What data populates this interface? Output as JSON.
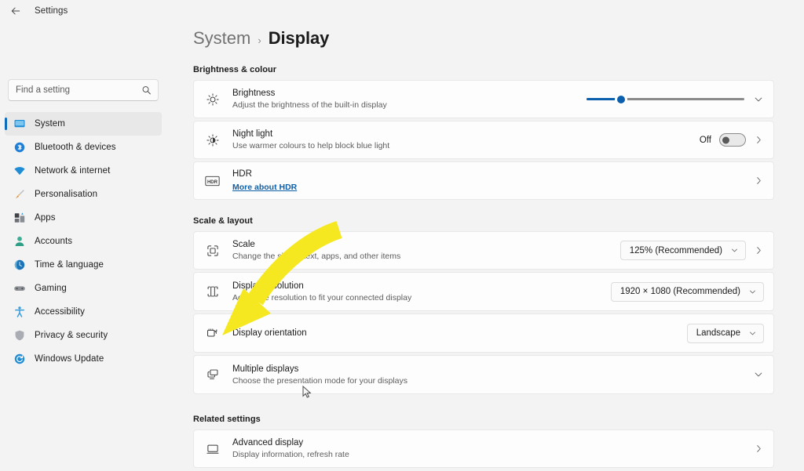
{
  "window": {
    "back_icon": "back-arrow-icon",
    "title": "Settings"
  },
  "search": {
    "placeholder": "Find a setting",
    "value": "",
    "icon": "search-icon"
  },
  "sidebar": {
    "items": [
      {
        "label": "System",
        "icon": "monitor-icon",
        "selected": true
      },
      {
        "label": "Bluetooth & devices",
        "icon": "bluetooth-icon",
        "selected": false
      },
      {
        "label": "Network & internet",
        "icon": "wifi-icon",
        "selected": false
      },
      {
        "label": "Personalisation",
        "icon": "paintbrush-icon",
        "selected": false
      },
      {
        "label": "Apps",
        "icon": "apps-icon",
        "selected": false
      },
      {
        "label": "Accounts",
        "icon": "account-icon",
        "selected": false
      },
      {
        "label": "Time & language",
        "icon": "globe-clock-icon",
        "selected": false
      },
      {
        "label": "Gaming",
        "icon": "gamepad-icon",
        "selected": false
      },
      {
        "label": "Accessibility",
        "icon": "accessibility-icon",
        "selected": false
      },
      {
        "label": "Privacy & security",
        "icon": "shield-icon",
        "selected": false
      },
      {
        "label": "Windows Update",
        "icon": "update-icon",
        "selected": false
      }
    ]
  },
  "breadcrumb": {
    "parent": "System",
    "separator": "›",
    "current": "Display"
  },
  "sections": {
    "brightness_colour": {
      "title": "Brightness & colour",
      "brightness": {
        "title": "Brightness",
        "subtitle": "Adjust the brightness of the built-in display",
        "icon": "sun-icon",
        "slider_percent": 22,
        "expand_icon": "chevron-down-icon"
      },
      "night_light": {
        "title": "Night light",
        "subtitle": "Use warmer colours to help block blue light",
        "icon": "night-light-icon",
        "toggle_label": "Off",
        "toggle_on": false,
        "chevron_icon": "chevron-right-icon"
      },
      "hdr": {
        "title": "HDR",
        "link": "More about HDR",
        "icon": "hdr-icon",
        "chevron_icon": "chevron-right-icon"
      }
    },
    "scale_layout": {
      "title": "Scale & layout",
      "scale": {
        "title": "Scale",
        "subtitle": "Change the size of text, apps, and other items",
        "icon": "scale-icon",
        "value": "125% (Recommended)",
        "dropdown_icon": "chevron-down-icon",
        "chevron_icon": "chevron-right-icon"
      },
      "resolution": {
        "title": "Display resolution",
        "subtitle": "Adjust the resolution to fit your connected display",
        "icon": "resolution-icon",
        "value": "1920 × 1080 (Recommended)",
        "dropdown_icon": "chevron-down-icon"
      },
      "orientation": {
        "title": "Display orientation",
        "subtitle": "",
        "icon": "orientation-icon",
        "value": "Landscape",
        "dropdown_icon": "chevron-down-icon"
      },
      "multiple_displays": {
        "title": "Multiple displays",
        "subtitle": "Choose the presentation mode for your displays",
        "icon": "multiple-displays-icon",
        "expand_icon": "chevron-down-icon"
      }
    },
    "related_settings": {
      "title": "Related settings",
      "advanced_display": {
        "title": "Advanced display",
        "subtitle": "Display information, refresh rate",
        "icon": "advanced-display-icon",
        "chevron_icon": "chevron-right-icon"
      }
    }
  },
  "annotation": {
    "type": "curved-arrow",
    "colour": "#f5e821",
    "points_to": "Multiple displays"
  },
  "colours": {
    "accent": "#0f6cbd",
    "page_background": "#f3f3f3",
    "card_background": "#fdfdfd",
    "link": "#0d5fa8",
    "annotation_yellow": "#f5e821"
  }
}
